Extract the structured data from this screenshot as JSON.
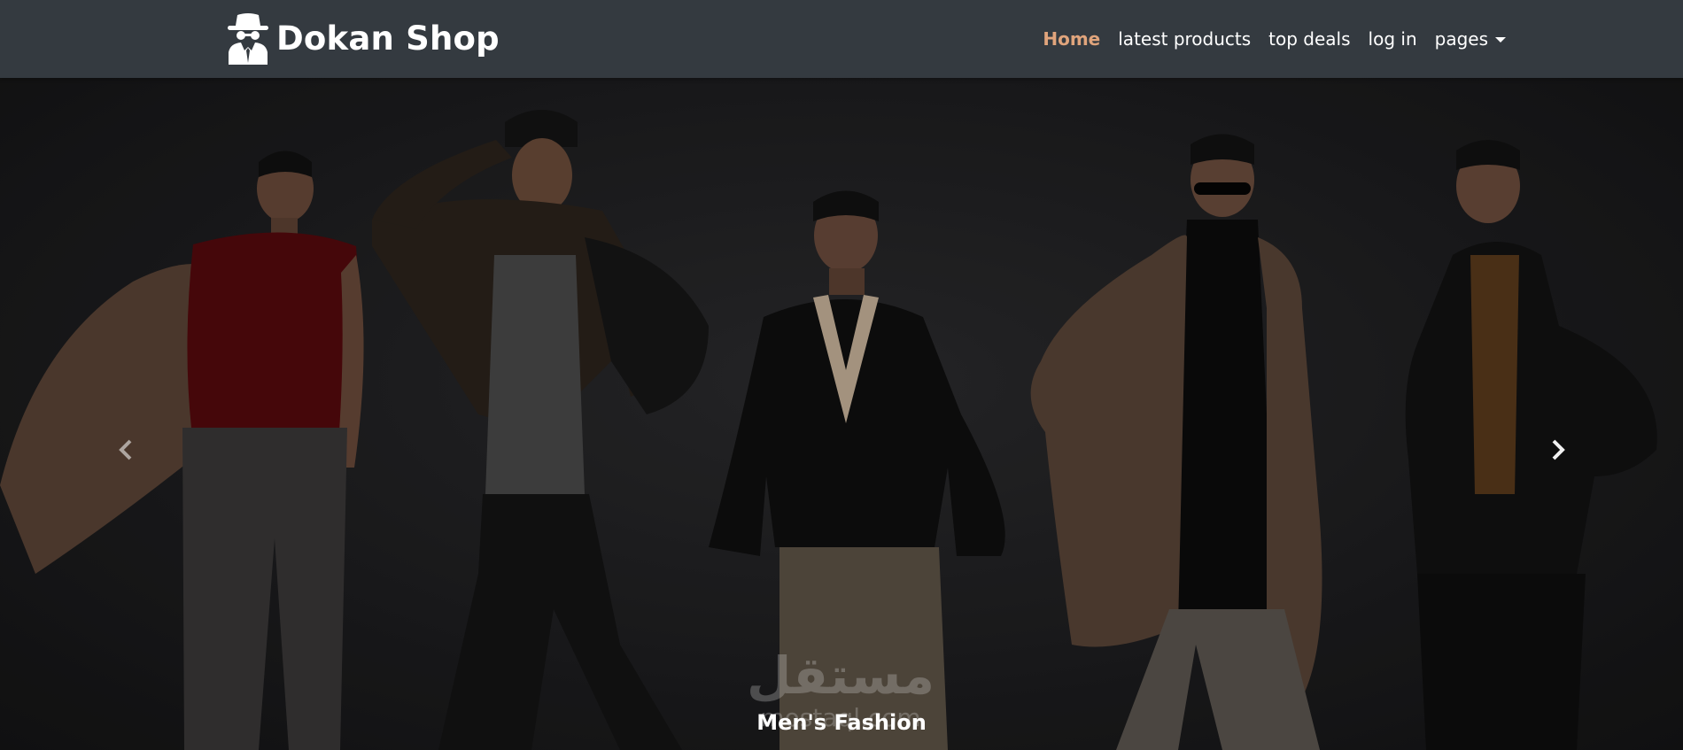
{
  "navbar": {
    "brand": "Dokan Shop",
    "brand_icon": "incognito-spy-icon",
    "links": [
      {
        "label": "Home",
        "active": true
      },
      {
        "label": "latest products",
        "active": false
      },
      {
        "label": "top deals",
        "active": false
      },
      {
        "label": "log in",
        "active": false
      },
      {
        "label": "pages",
        "active": false,
        "dropdown": true
      }
    ]
  },
  "carousel": {
    "caption": "Men's Fashion",
    "prev_icon": "chevron-left-icon",
    "next_icon": "chevron-right-icon"
  },
  "watermark": {
    "arabic": "مستقل",
    "latin": "mostaql.com"
  },
  "colors": {
    "navbar_bg": "#343a40",
    "active_link": "#e0a47c",
    "text": "#ffffff"
  }
}
